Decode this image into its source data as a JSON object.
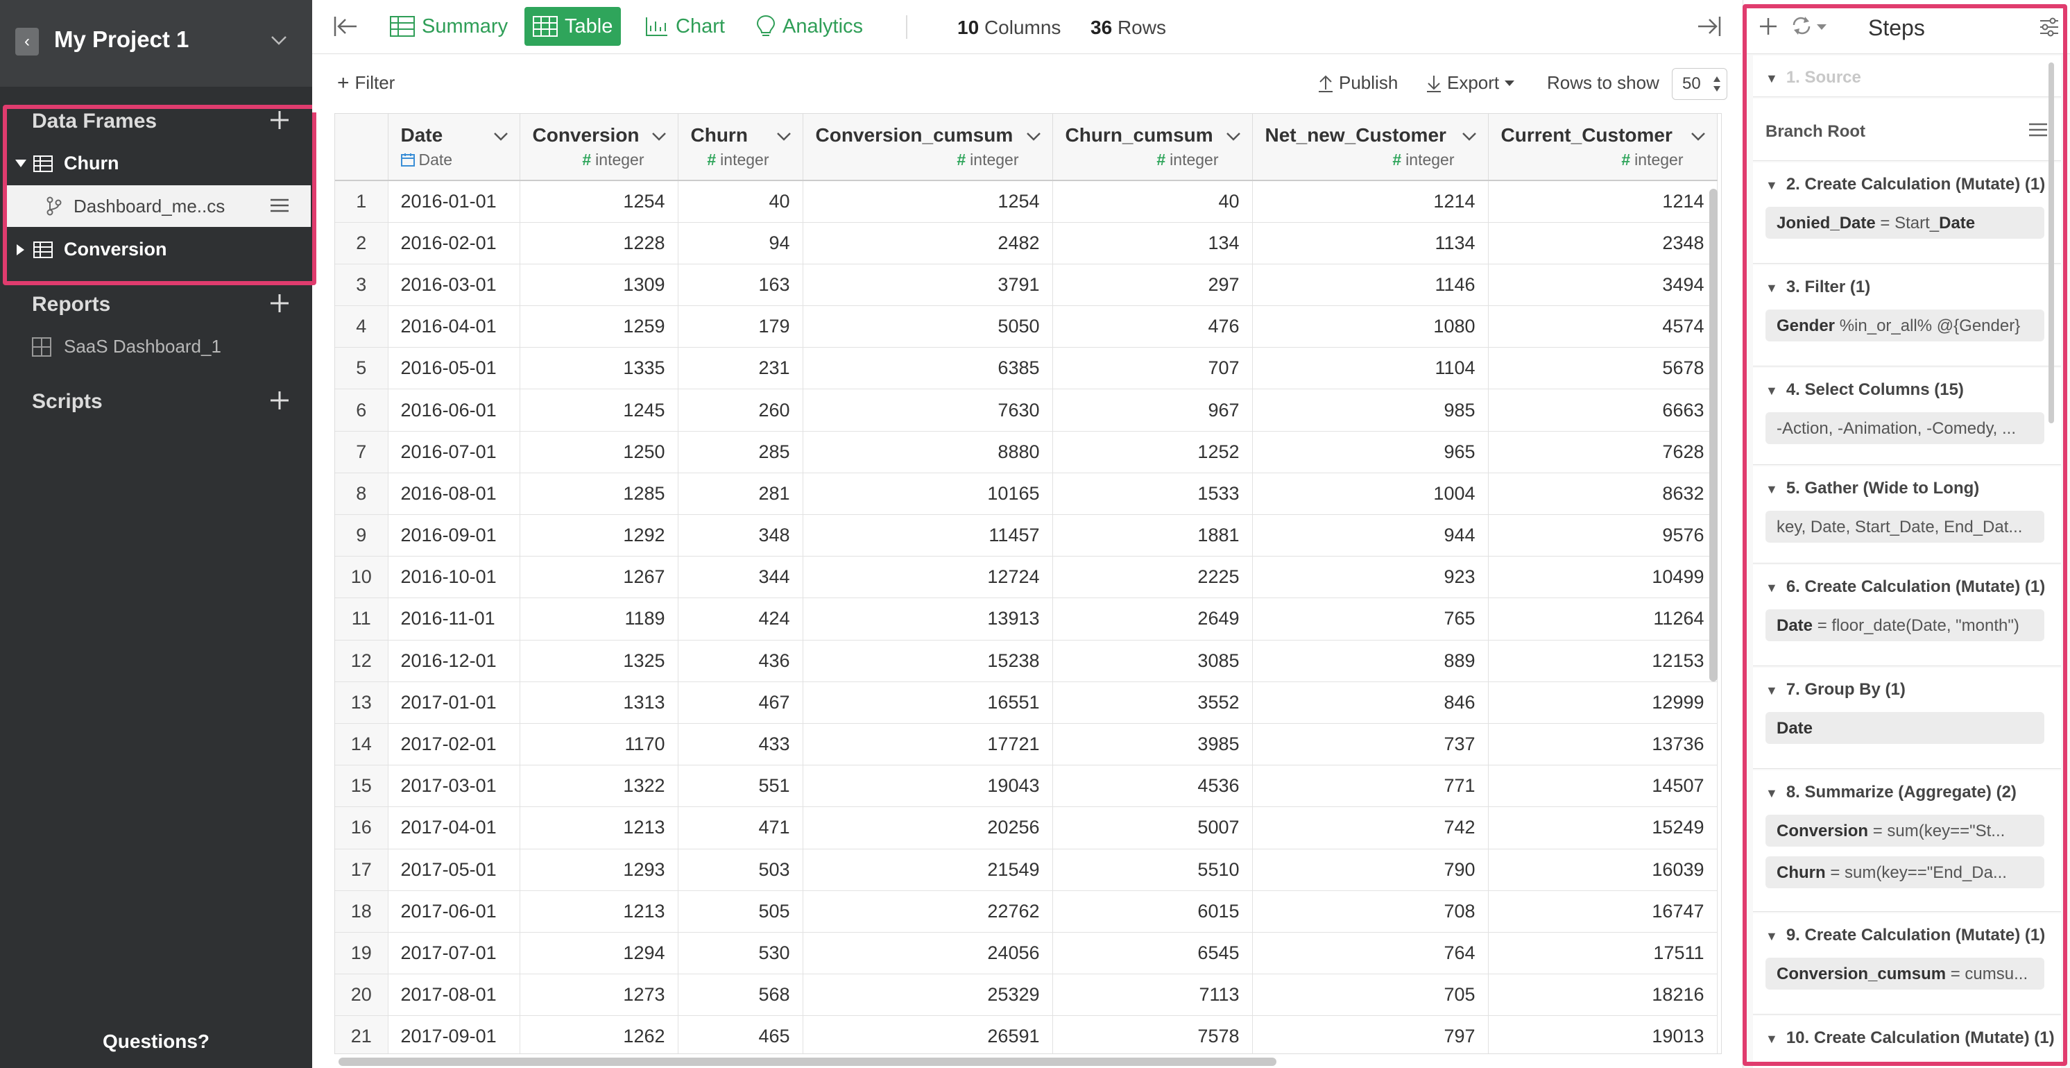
{
  "project": {
    "title": "My Project 1"
  },
  "sidebar": {
    "data_frames_title": "Data Frames",
    "data_frames": [
      {
        "label": "Churn"
      },
      {
        "label": "Conversion"
      }
    ],
    "branch_label": "Dashboard_me..cs",
    "reports_title": "Reports",
    "reports": [
      {
        "label": "SaaS Dashboard_1"
      }
    ],
    "scripts_title": "Scripts",
    "questions": "Questions?"
  },
  "toolbar": {
    "summary": "Summary",
    "table": "Table",
    "chart": "Chart",
    "analytics": "Analytics",
    "columns_count": "10",
    "columns_label": "Columns",
    "rows_count": "36",
    "rows_label": "Rows"
  },
  "subbar": {
    "filter": "Filter",
    "publish": "Publish",
    "export": "Export",
    "rows_to_show_label": "Rows to show",
    "rows_to_show_value": "50"
  },
  "table": {
    "columns": [
      {
        "name": "Date",
        "type": "Date",
        "kind": "date"
      },
      {
        "name": "Conversion",
        "type": "integer",
        "kind": "num"
      },
      {
        "name": "Churn",
        "type": "integer",
        "kind": "num"
      },
      {
        "name": "Conversion_cumsum",
        "type": "integer",
        "kind": "num"
      },
      {
        "name": "Churn_cumsum",
        "type": "integer",
        "kind": "num"
      },
      {
        "name": "Net_new_Customer",
        "type": "integer",
        "kind": "num"
      },
      {
        "name": "Current_Customer",
        "type": "integer",
        "kind": "num"
      }
    ],
    "rows": [
      [
        "1",
        "2016-01-01",
        "1254",
        "40",
        "1254",
        "40",
        "1214",
        "1214"
      ],
      [
        "2",
        "2016-02-01",
        "1228",
        "94",
        "2482",
        "134",
        "1134",
        "2348"
      ],
      [
        "3",
        "2016-03-01",
        "1309",
        "163",
        "3791",
        "297",
        "1146",
        "3494"
      ],
      [
        "4",
        "2016-04-01",
        "1259",
        "179",
        "5050",
        "476",
        "1080",
        "4574"
      ],
      [
        "5",
        "2016-05-01",
        "1335",
        "231",
        "6385",
        "707",
        "1104",
        "5678"
      ],
      [
        "6",
        "2016-06-01",
        "1245",
        "260",
        "7630",
        "967",
        "985",
        "6663"
      ],
      [
        "7",
        "2016-07-01",
        "1250",
        "285",
        "8880",
        "1252",
        "965",
        "7628"
      ],
      [
        "8",
        "2016-08-01",
        "1285",
        "281",
        "10165",
        "1533",
        "1004",
        "8632"
      ],
      [
        "9",
        "2016-09-01",
        "1292",
        "348",
        "11457",
        "1881",
        "944",
        "9576"
      ],
      [
        "10",
        "2016-10-01",
        "1267",
        "344",
        "12724",
        "2225",
        "923",
        "10499"
      ],
      [
        "11",
        "2016-11-01",
        "1189",
        "424",
        "13913",
        "2649",
        "765",
        "11264"
      ],
      [
        "12",
        "2016-12-01",
        "1325",
        "436",
        "15238",
        "3085",
        "889",
        "12153"
      ],
      [
        "13",
        "2017-01-01",
        "1313",
        "467",
        "16551",
        "3552",
        "846",
        "12999"
      ],
      [
        "14",
        "2017-02-01",
        "1170",
        "433",
        "17721",
        "3985",
        "737",
        "13736"
      ],
      [
        "15",
        "2017-03-01",
        "1322",
        "551",
        "19043",
        "4536",
        "771",
        "14507"
      ],
      [
        "16",
        "2017-04-01",
        "1213",
        "471",
        "20256",
        "5007",
        "742",
        "15249"
      ],
      [
        "17",
        "2017-05-01",
        "1293",
        "503",
        "21549",
        "5510",
        "790",
        "16039"
      ],
      [
        "18",
        "2017-06-01",
        "1213",
        "505",
        "22762",
        "6015",
        "708",
        "16747"
      ],
      [
        "19",
        "2017-07-01",
        "1294",
        "530",
        "24056",
        "6545",
        "764",
        "17511"
      ],
      [
        "20",
        "2017-08-01",
        "1273",
        "568",
        "25329",
        "7113",
        "705",
        "18216"
      ],
      [
        "21",
        "2017-09-01",
        "1262",
        "465",
        "26591",
        "7578",
        "797",
        "19013"
      ]
    ]
  },
  "steps": {
    "title": "Steps",
    "source": "1. Source",
    "branch_root": "Branch Root",
    "items": [
      {
        "title": "2. Create Calculation (Mutate) (1)",
        "chips": [
          {
            "a": "Jonied_Date",
            "b": " = Start_",
            "c": "Date"
          }
        ]
      },
      {
        "title": "3. Filter (1)",
        "chips": [
          {
            "a": "Gender",
            "b": " %in_or_all% @{Gender}",
            "c": ""
          }
        ]
      },
      {
        "title": "4. Select Columns (15)",
        "chips": [
          {
            "a": "",
            "b": "-Action, -Animation, -Comedy, ...",
            "c": ""
          }
        ]
      },
      {
        "title": "5. Gather (Wide to Long)",
        "chips": [
          {
            "a": "",
            "b": "key, Date, Start_Date, End_Dat...",
            "c": ""
          }
        ]
      },
      {
        "title": "6. Create Calculation (Mutate) (1)",
        "chips": [
          {
            "a": "Date",
            "b": " = floor_date(Date, \"month\")",
            "c": ""
          }
        ]
      },
      {
        "title": "7. Group By (1)",
        "chips": [
          {
            "a": "Date",
            "b": "",
            "c": ""
          }
        ]
      },
      {
        "title": "8. Summarize (Aggregate) (2)",
        "chips": [
          {
            "a": "Conversion",
            "b": " = sum(key==\"St...",
            "c": ""
          },
          {
            "a": "Churn",
            "b": " = sum(key==\"End_Da...",
            "c": ""
          }
        ]
      },
      {
        "title": "9. Create Calculation (Mutate) (1)",
        "chips": [
          {
            "a": "Conversion_cumsum",
            "b": " = cumsu...",
            "c": ""
          }
        ]
      },
      {
        "title": "10. Create Calculation (Mutate) (1)",
        "chips": []
      }
    ]
  }
}
